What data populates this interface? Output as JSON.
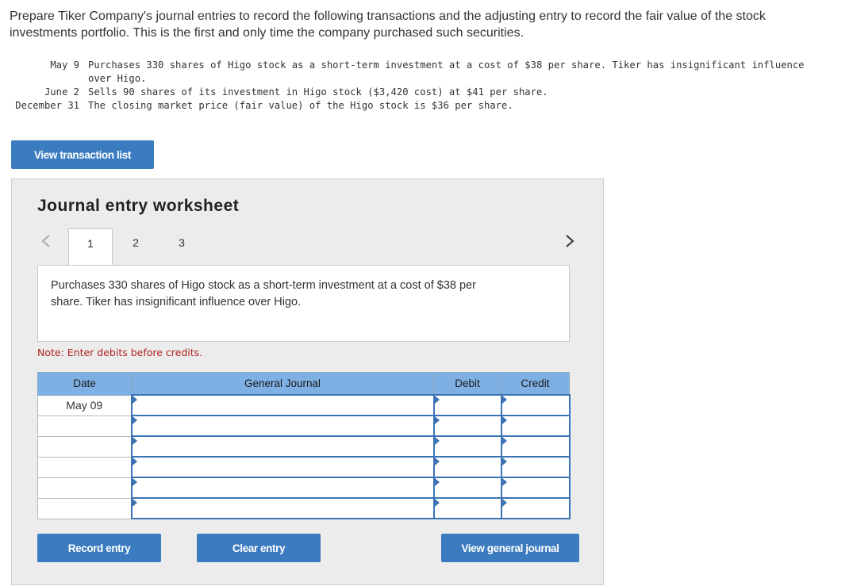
{
  "intro": {
    "text": "Prepare Tiker Company's journal entries to record the following transactions and the adjusting entry to record the fair value of the stock investments portfolio. This is the first and only time the company purchased such securities."
  },
  "transactions": [
    {
      "date": "May 9",
      "description": "Purchases 330 shares of Higo stock as a short-term investment at a cost of $38 per share. Tiker has insignificant influence over Higo."
    },
    {
      "date": "June 2",
      "description": "Sells 90 shares of its investment in Higo stock ($3,420 cost) at $41 per share."
    },
    {
      "date": "December 31",
      "description": "The closing market price (fair value) of the Higo stock is $36 per share."
    }
  ],
  "buttons": {
    "view_transaction_list": "View transaction list",
    "record_entry": "Record entry",
    "clear_entry": "Clear entry",
    "view_general_journal": "View general journal"
  },
  "worksheet": {
    "title": "Journal entry worksheet",
    "tabs": [
      "1",
      "2",
      "3"
    ],
    "active_tab": "1",
    "nav_prev_icon": "chevron-left-icon",
    "nav_next_icon": "chevron-right-icon",
    "description": "Purchases 330 shares of Higo stock as a short-term investment at a cost of $38 per share. Tiker has insignificant influence over Higo.",
    "note": "Note: Enter debits before credits."
  },
  "journal_table": {
    "headers": [
      "Date",
      "General Journal",
      "Debit",
      "Credit"
    ],
    "rows": [
      {
        "date": "May 09",
        "account": "",
        "debit": "",
        "credit": ""
      },
      {
        "date": "",
        "account": "",
        "debit": "",
        "credit": ""
      },
      {
        "date": "",
        "account": "",
        "debit": "",
        "credit": ""
      },
      {
        "date": "",
        "account": "",
        "debit": "",
        "credit": ""
      },
      {
        "date": "",
        "account": "",
        "debit": "",
        "credit": ""
      },
      {
        "date": "",
        "account": "",
        "debit": "",
        "credit": ""
      }
    ]
  },
  "colors": {
    "button_blue": "#3b7bc0",
    "header_blue": "#7fb0e4",
    "note_red": "#b22222"
  }
}
